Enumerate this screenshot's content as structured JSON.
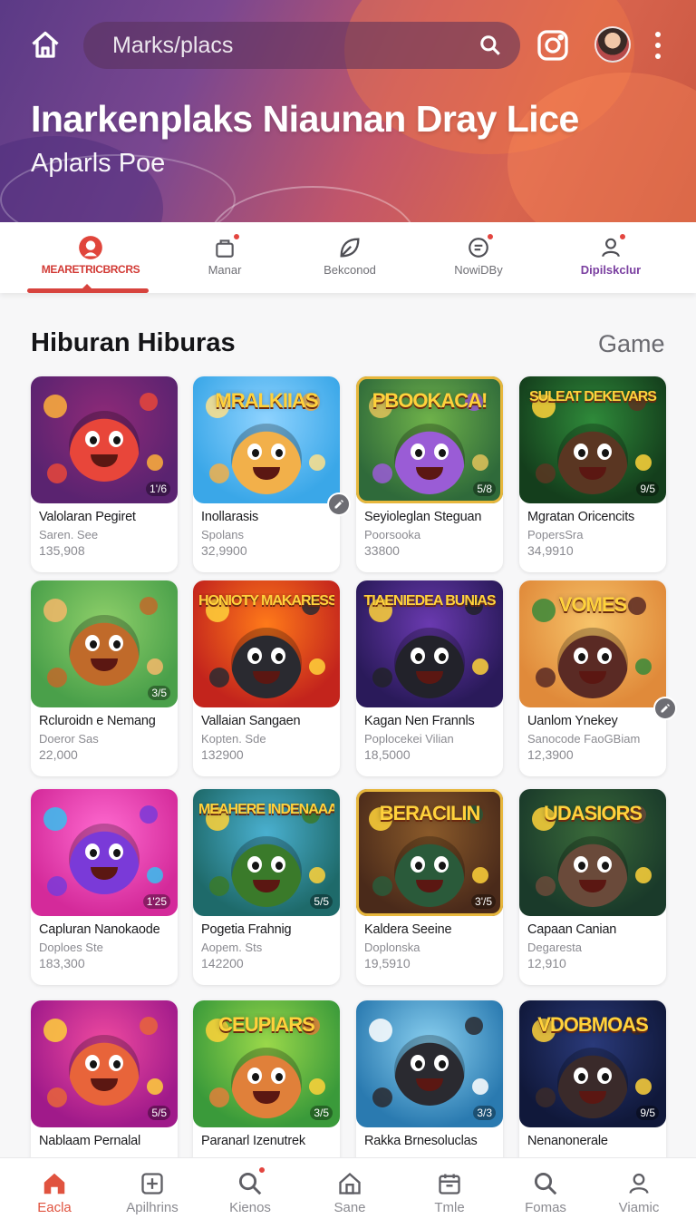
{
  "header": {
    "search_placeholder": "Marks/placs",
    "title": "Inarkenplaks Niaunan Dray Lice",
    "subtitle": "Aplarls Poe",
    "icons": [
      "home-icon",
      "search-icon",
      "instagram-icon",
      "avatar",
      "more-vertical-icon"
    ]
  },
  "tabs": [
    {
      "label": "MEARETRICBRCRS",
      "icon": "profile-icon",
      "active": true,
      "badge": false
    },
    {
      "label": "Manar",
      "icon": "bag-icon",
      "active": false,
      "badge": true
    },
    {
      "label": "Bekconod",
      "icon": "leaf-icon",
      "active": false,
      "badge": false
    },
    {
      "label": "NowiDBy",
      "icon": "chat-icon",
      "active": false,
      "badge": true
    },
    {
      "label": "Dipilskclur",
      "icon": "user-icon",
      "active": false,
      "badge": true
    }
  ],
  "section": {
    "title": "Hiburan Hiburas",
    "link": "Game"
  },
  "cards": [
    {
      "name": "Valolaran Pegiret",
      "sub": "Saren. See",
      "count": "135,908",
      "rating": "1'/6",
      "banner": "",
      "theme": "purple"
    },
    {
      "name": "Inollarasis",
      "sub": "Spolans",
      "count": "32,9900",
      "rating": "",
      "banner": "MRALKIIAS",
      "theme": "sky"
    },
    {
      "name": "Seyioleglan Steguan",
      "sub": "Poorsooka",
      "count": "33800",
      "rating": "5/8",
      "banner": "PBOOKACA!",
      "theme": "forest"
    },
    {
      "name": "Mgratan Oricencits",
      "sub": "PopersSra",
      "count": "34,9910",
      "rating": "9/5",
      "banner": "SULEAT DEKEVARS",
      "theme": "green"
    },
    {
      "name": "Rcluroidn e Nemang",
      "sub": "Doeror Sas",
      "count": "22,000",
      "rating": "3/5",
      "banner": "",
      "theme": "meadow"
    },
    {
      "name": "Vallaian Sangaen",
      "sub": "Kopten. Sde",
      "count": "132900",
      "rating": "",
      "banner": "HONIOTY MAKARESS",
      "theme": "fire"
    },
    {
      "name": "Kagan Nen Frannls",
      "sub": "Poplocekei Vilian",
      "count": "18,5000",
      "rating": "",
      "banner": "TIAENIEDEA BUNIAS",
      "theme": "violet"
    },
    {
      "name": "Uanlom Ynekey",
      "sub": "Sanocode FaoGBiam",
      "count": "12,3900",
      "rating": "",
      "banner": "VOMES",
      "theme": "sunset"
    },
    {
      "name": "Capluran Nanokaode",
      "sub": "Doploes Ste",
      "count": "183,300",
      "rating": "1'25",
      "banner": "",
      "theme": "candy"
    },
    {
      "name": "Pogetia Frahnig",
      "sub": "Aopem. Sts",
      "count": "142200",
      "rating": "5/5",
      "banner": "MEAHERE INDENAAAS",
      "theme": "jungle"
    },
    {
      "name": "Kaldera Seeine",
      "sub": "Doplonska",
      "count": "19,5910",
      "rating": "3'/5",
      "banner": "BERACILIN",
      "theme": "wood"
    },
    {
      "name": "Capaan Canian",
      "sub": "Degaresta",
      "count": "12,910",
      "rating": "",
      "banner": "UDASIORS",
      "theme": "woods"
    },
    {
      "name": "Nablaam Pernalal",
      "sub": "",
      "count": "",
      "rating": "5/5",
      "banner": "",
      "theme": "magenta"
    },
    {
      "name": "Paranarl Izenutrek",
      "sub": "",
      "count": "",
      "rating": "3/5",
      "banner": "CEUPIARS",
      "theme": "grass"
    },
    {
      "name": "Rakka Brnesoluclas",
      "sub": "",
      "count": "",
      "rating": "3/3",
      "banner": "",
      "theme": "lake"
    },
    {
      "name": "Nenanonerale",
      "sub": "",
      "count": "",
      "rating": "9/5",
      "banner": "VDOBMOAS",
      "theme": "night"
    }
  ],
  "bottom_nav": [
    {
      "label": "Eacla",
      "icon": "home-icon",
      "active": true
    },
    {
      "label": "Apilhrins",
      "icon": "add-square-icon",
      "active": false
    },
    {
      "label": "Kienos",
      "icon": "search-icon",
      "active": false,
      "badge": true
    },
    {
      "label": "Sane",
      "icon": "house-outline-icon",
      "active": false
    },
    {
      "label": "Tmle",
      "icon": "calendar-icon",
      "active": false
    },
    {
      "label": "Fomas",
      "icon": "search-icon",
      "active": false
    },
    {
      "label": "Viamic",
      "icon": "profile-icon",
      "active": false
    }
  ],
  "colors": {
    "accent": "#d7433d",
    "header_start": "#5b3a86",
    "header_end": "#d9654f"
  }
}
